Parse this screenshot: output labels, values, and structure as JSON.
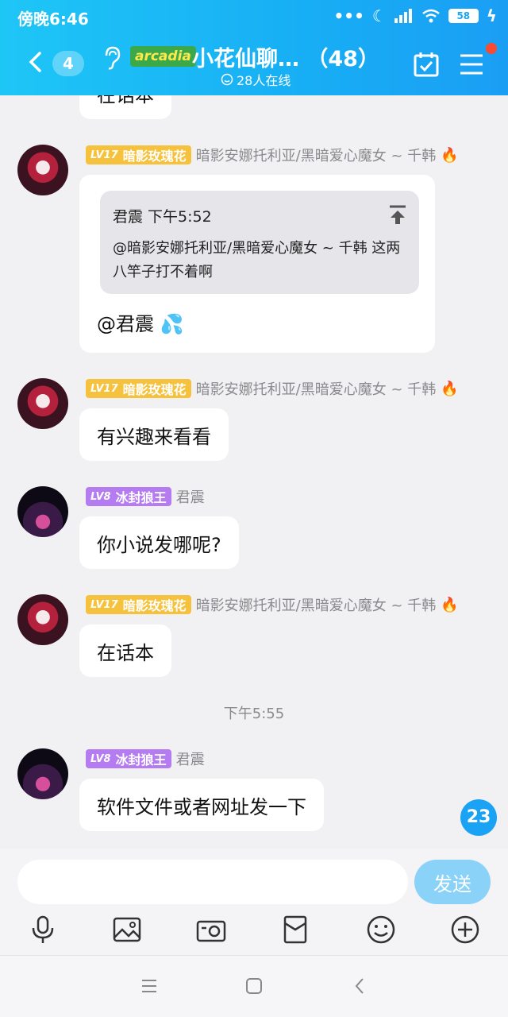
{
  "status": {
    "time": "傍晚6:46",
    "battery": "58"
  },
  "header": {
    "unread": "4",
    "brand": "arcadia",
    "title": "小花仙聊…  （48）",
    "online": "28人在线"
  },
  "messages": [
    {
      "badge_lv": "LV17",
      "badge_title": "暗影玫瑰花",
      "name": "暗影安娜托利亚/黑暗爱心魔女 ~ 千韩",
      "quote_head": "君震  下午5:52",
      "quote_body": "@暗影安娜托利亚/黑暗爱心魔女 ~ 千韩 这两八竿子打不着啊",
      "text": "@君震 💦"
    },
    {
      "badge_lv": "LV17",
      "badge_title": "暗影玫瑰花",
      "name": "暗影安娜托利亚/黑暗爱心魔女 ~ 千韩",
      "text": "有兴趣来看看"
    },
    {
      "badge_lv": "LV8",
      "badge_title": "冰封狼王",
      "name": "君震",
      "text": "你小说发哪呢?"
    },
    {
      "badge_lv": "LV17",
      "badge_title": "暗影玫瑰花",
      "name": "暗影安娜托利亚/黑暗爱心魔女 ~ 千韩",
      "text": "在话本"
    },
    {
      "badge_lv": "LV8",
      "badge_title": "冰封狼王",
      "name": "君震",
      "text": "软件文件或者网址发一下"
    }
  ],
  "partial_top_text": "在话本",
  "time_separator": "下午5:55",
  "new_count": "23",
  "input": {
    "placeholder": "",
    "send_label": "发送"
  },
  "colors": {
    "header": "#18aef5",
    "gold_badge": "#f6c13c",
    "purple_badge": "#b47cf0",
    "send": "#8bd2f9"
  }
}
